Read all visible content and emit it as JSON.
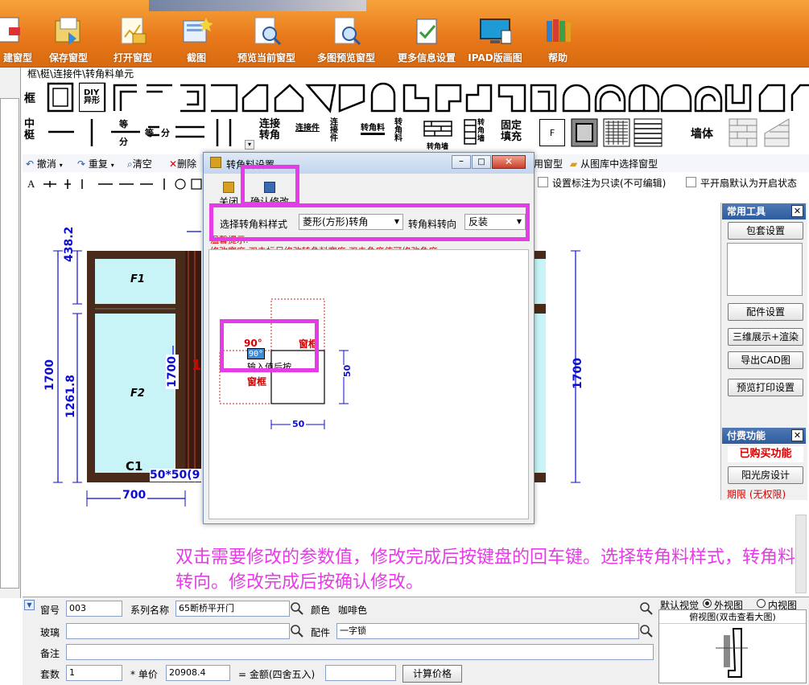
{
  "toolbar": {
    "items": [
      {
        "label": "建窗型",
        "icon": "new-window-icon"
      },
      {
        "label": "保存窗型",
        "icon": "save-window-icon"
      },
      {
        "label": "打开窗型",
        "icon": "open-window-icon"
      },
      {
        "label": "截图",
        "icon": "screenshot-icon"
      },
      {
        "label": "预览当前窗型",
        "icon": "preview-icon"
      },
      {
        "label": "多图预览窗型",
        "icon": "multi-preview-icon"
      },
      {
        "label": "更多信息设置",
        "icon": "settings-doc-icon"
      },
      {
        "label": "IPAD版画图",
        "icon": "ipad-icon"
      },
      {
        "label": "帮助",
        "icon": "help-books-icon"
      }
    ]
  },
  "shapes": {
    "path": "框\\梃\\连接件\\转角料单元",
    "row1_label": "框",
    "row2_label": "中梃",
    "diy_label": "DIY\n异形",
    "connector_labels": [
      "连接\n转角",
      "连接件",
      "连\n接\n件",
      "转角料",
      "转\n角\n料",
      "转角墙",
      "转\n角\n墙",
      "固定\n填充",
      "F"
    ],
    "wall_label": "墙体"
  },
  "editbar": {
    "undo": "撤消",
    "redo": "重复",
    "clear": "清空",
    "delete": "删除",
    "common_window": "用窗型",
    "pick_from_lib": "从图库中选择窗型",
    "readonly_label": "设置标注为只读(不可编辑)",
    "default_open_label": "平开扇默认为开启状态"
  },
  "drawing": {
    "top_height": "438.2",
    "bottom_height": "1261.8",
    "total_height_left": "1700",
    "mid_height": "1700",
    "right_height": "1700",
    "pane1": "F1",
    "pane2": "F2",
    "label_c1": "C1",
    "spec_label": "50*50(9",
    "width_left": "700",
    "red_marker": "1"
  },
  "dialog": {
    "title": "转角料设置",
    "close_btn": "关闭",
    "confirm_btn": "确认修改",
    "style_label": "选择转角料样式",
    "style_value": "菱形(方形)转角",
    "direction_label": "转角料转向",
    "direction_value": "反装",
    "hint_title": "温馨提示:",
    "hint_text": "修改宽度:双击标尺修改转角料宽度;双击角度值可修改角度",
    "angle_label": "90°",
    "angle_input": "90°",
    "input_hint": "输入值后按",
    "frame_label_top": "窗框",
    "frame_label_bottom": "窗框",
    "dim_width": "50",
    "dim_height": "50"
  },
  "right_panel": {
    "tools_title": "常用工具",
    "btn_package": "包套设置",
    "btn_parts": "配件设置",
    "btn_3d": "三维展示+渲染",
    "btn_cad": "导出CAD图",
    "btn_print": "预览打印设置",
    "paid_title": "付费功能",
    "purchased": "已购买功能",
    "btn_sunroom": "阳光房设计",
    "term": "期限 (无权限)"
  },
  "instruction": "双击需要修改的参数值，修改完成后按键盘的回车键。选择转角料样式，转角料转向。修改完成后按确认修改。",
  "form": {
    "window_no_label": "窗号",
    "window_no": "003",
    "series_label": "系列名称",
    "series": "65断桥平开门",
    "color_label": "颜色",
    "color": "咖啡色",
    "glass_label": "玻璃",
    "glass": "",
    "parts_label": "配件",
    "parts": "一字锁",
    "note_label": "备注",
    "note": "",
    "sets_label": "套数",
    "sets": "1",
    "unit_price_label": "* 单价",
    "unit_price": "20908.4",
    "amount_label": "= 金额(四舍五入)",
    "amount": "",
    "calc_btn": "计算价格",
    "view_label": "默认视觉",
    "outer_view": "外视图",
    "inner_view": "内视图",
    "top_view_label": "俯视图(双击查看大图)"
  }
}
